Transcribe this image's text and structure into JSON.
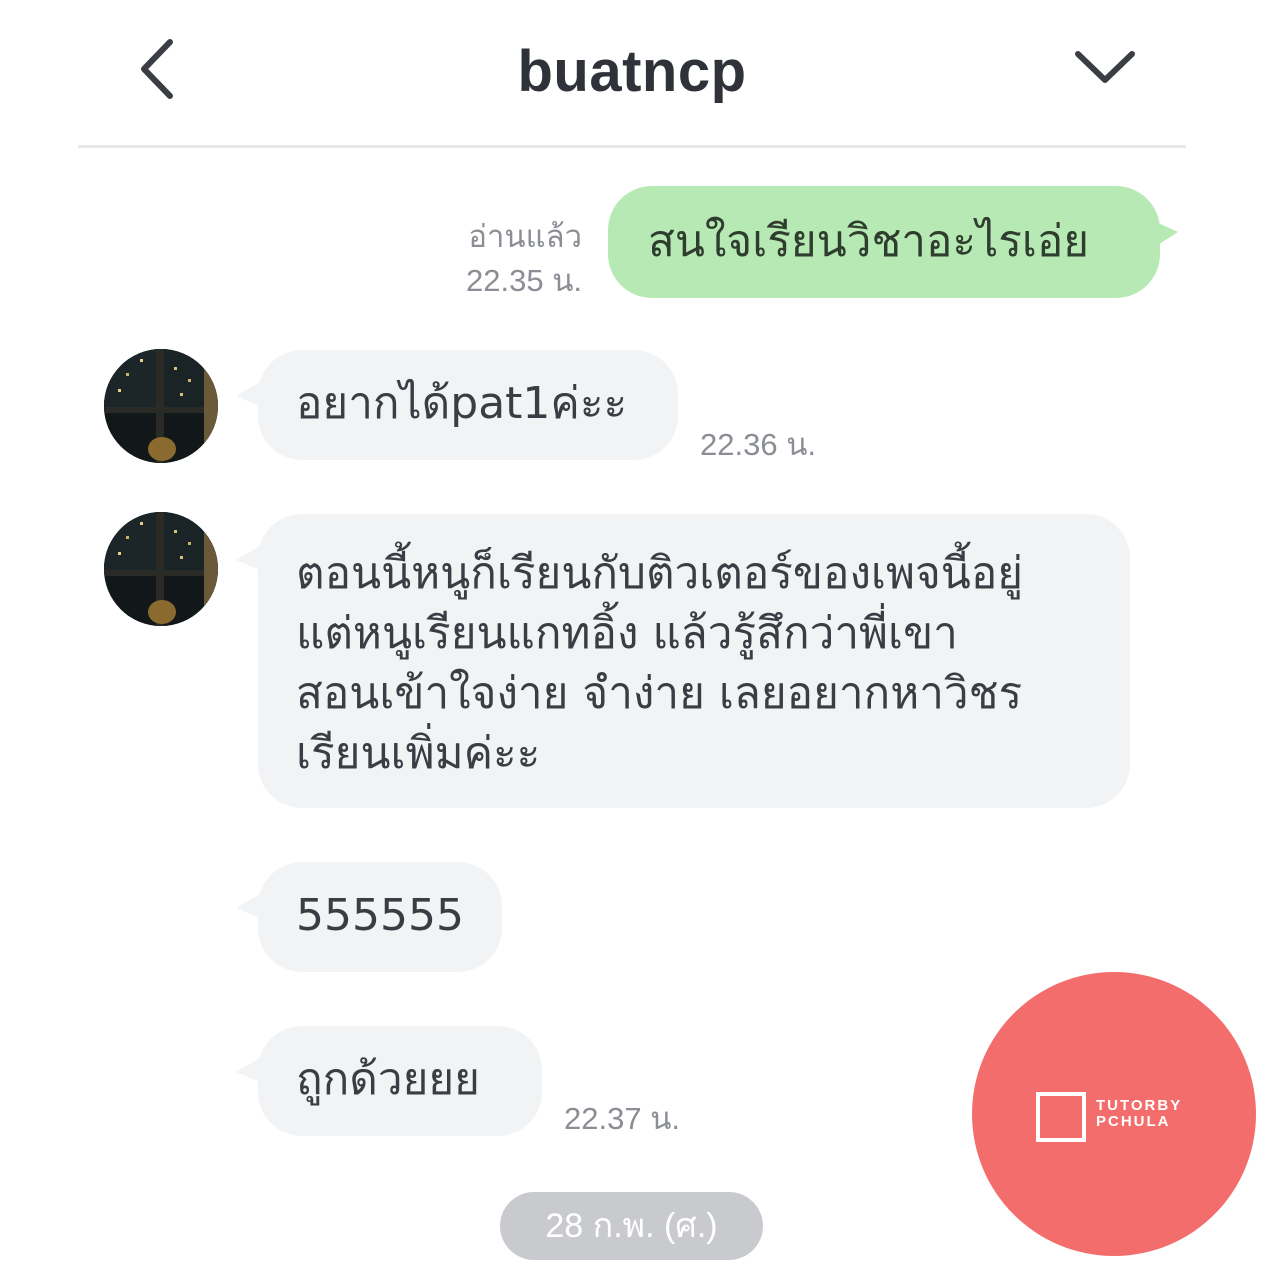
{
  "header": {
    "title": "buatncp",
    "back_icon": "chevron-left-icon",
    "menu_icon": "chevron-down-icon"
  },
  "messages": [
    {
      "direction": "out",
      "text": "สนใจเรียนวิชาอะไรเอ่ย",
      "read_status": "อ่านแล้ว",
      "time": "22.35 น."
    },
    {
      "direction": "in",
      "text": "อยากได้pat1ค่ะะ",
      "time": "22.36 น."
    },
    {
      "direction": "in",
      "lines": [
        "ตอนนี้หนูก็เรียนกับติวเตอร์ของเพจนี้อยู่",
        "แต่หนูเรียนแกทอิ้ง แล้วรู้สึกว่าพี่เขา",
        "สอนเข้าใจง่าย จำง่าย เลยอยากหาวิชร",
        "เรียนเพิ่มค่ะะ"
      ]
    },
    {
      "direction": "in",
      "text": "555555"
    },
    {
      "direction": "in",
      "text": "ถูกด้วยยย",
      "time": "22.37 น."
    }
  ],
  "date_separator": "28 ก.พ. (ศ.)",
  "watermark": {
    "line1": "TUTORBY",
    "line2": "PCHULA",
    "color": "#f36d6d"
  },
  "colors": {
    "outgoing_bubble": "#b7e9b4",
    "incoming_bubble": "#f2f3f5",
    "meta_text": "#8b8e94"
  }
}
